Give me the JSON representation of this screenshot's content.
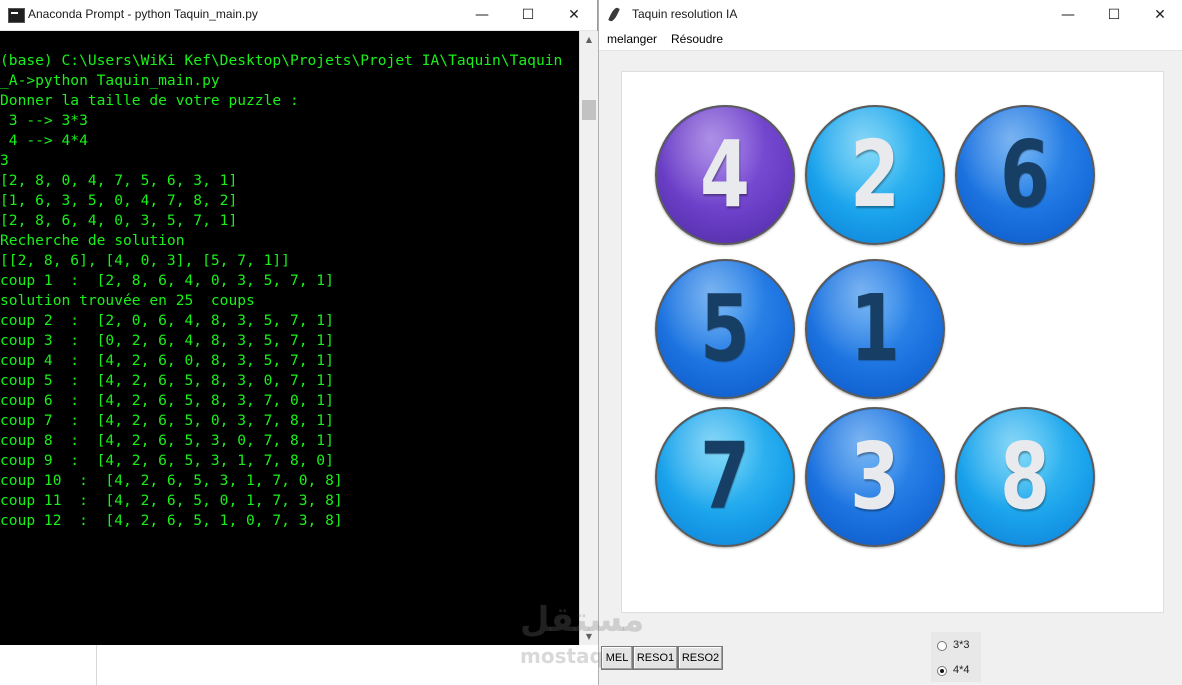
{
  "console": {
    "title": "Anaconda Prompt - python  Taquin_main.py",
    "lines": [
      "(base) C:\\Users\\WiKi Kef\\Desktop\\Projets\\Projet IA\\Taquin\\Taquin",
      "_A->python Taquin_main.py",
      "Donner la taille de votre puzzle :",
      " 3 --> 3*3",
      " 4 --> 4*4",
      "3",
      "[2, 8, 0, 4, 7, 5, 6, 3, 1]",
      "[1, 6, 3, 5, 0, 4, 7, 8, 2]",
      "[2, 8, 6, 4, 0, 3, 5, 7, 1]",
      "Recherche de solution",
      "[[2, 8, 6], [4, 0, 3], [5, 7, 1]]",
      "coup 1  :  [2, 8, 6, 4, 0, 3, 5, 7, 1]",
      "solution trouvée en 25  coups",
      "coup 2  :  [2, 0, 6, 4, 8, 3, 5, 7, 1]",
      "coup 3  :  [0, 2, 6, 4, 8, 3, 5, 7, 1]",
      "coup 4  :  [4, 2, 6, 0, 8, 3, 5, 7, 1]",
      "coup 5  :  [4, 2, 6, 5, 8, 3, 0, 7, 1]",
      "coup 6  :  [4, 2, 6, 5, 8, 3, 7, 0, 1]",
      "coup 7  :  [4, 2, 6, 5, 0, 3, 7, 8, 1]",
      "coup 8  :  [4, 2, 6, 5, 3, 0, 7, 8, 1]",
      "coup 9  :  [4, 2, 6, 5, 3, 1, 7, 8, 0]",
      "coup 10  :  [4, 2, 6, 5, 3, 1, 7, 0, 8]",
      "coup 11  :  [4, 2, 6, 5, 0, 1, 7, 3, 8]",
      "coup 12  :  [4, 2, 6, 5, 1, 0, 7, 3, 8]"
    ],
    "text_color": "#19f019",
    "background": "#000000"
  },
  "window_controls": {
    "minimize": "—",
    "maximize": "☐",
    "close": "✕"
  },
  "app": {
    "title": "Taquin resolution IA",
    "menu": [
      "melanger",
      "Résoudre"
    ],
    "tiles": [
      {
        "label": "4",
        "style": "purple",
        "text": "white",
        "cell": 0
      },
      {
        "label": "2",
        "style": "cyan",
        "text": "white",
        "cell": 1
      },
      {
        "label": "6",
        "style": "blue",
        "text": "dark",
        "cell": 2
      },
      {
        "label": "5",
        "style": "blue",
        "text": "dark",
        "cell": 3
      },
      {
        "label": "1",
        "style": "blue",
        "text": "dark",
        "cell": 4
      },
      {
        "label": "7",
        "style": "cyan",
        "text": "dark",
        "cell": 6
      },
      {
        "label": "3",
        "style": "blue",
        "text": "white",
        "cell": 7
      },
      {
        "label": "8",
        "style": "cyan",
        "text": "white",
        "cell": 8
      }
    ],
    "empty_cell": 5,
    "buttons": [
      "MEL",
      "RESO1",
      "RESO2"
    ],
    "size_options": [
      {
        "label": "3*3",
        "selected": false
      },
      {
        "label": "4*4",
        "selected": true
      }
    ]
  },
  "watermark": {
    "arabic": "مستقل",
    "latin": "mostaq"
  }
}
